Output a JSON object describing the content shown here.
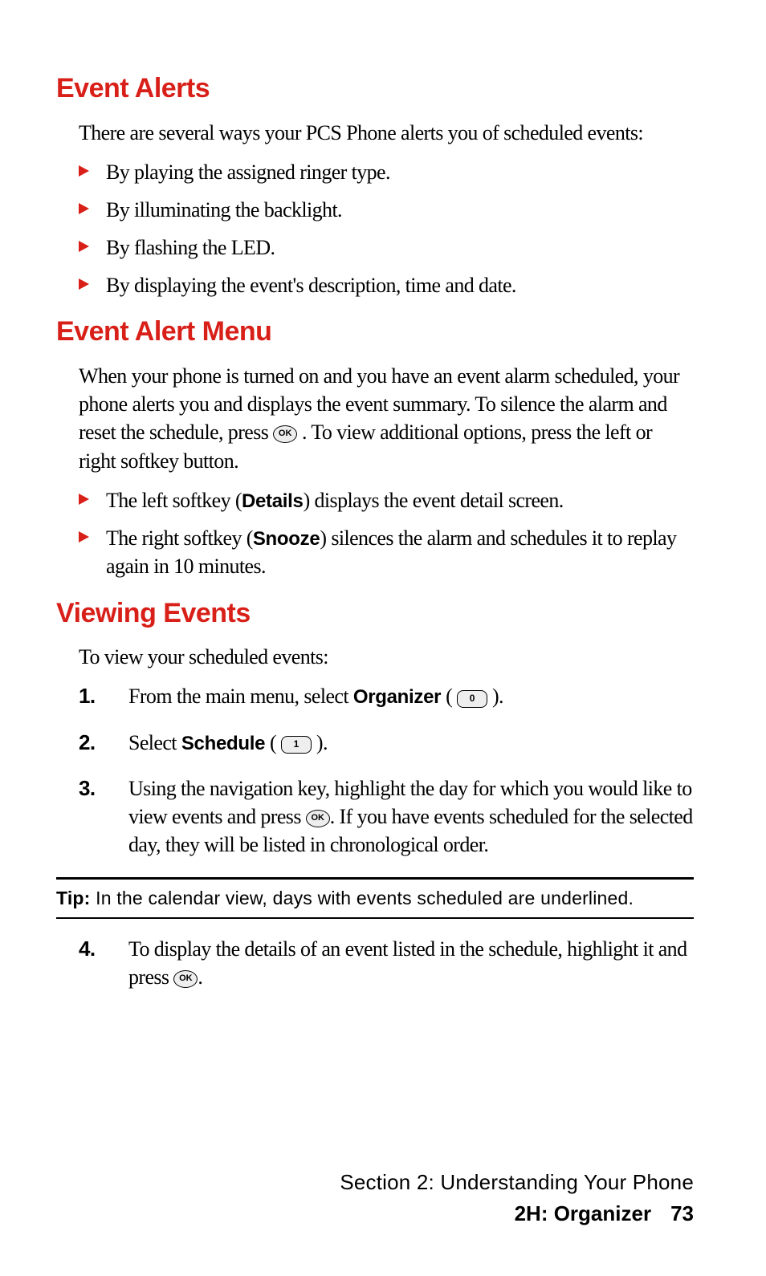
{
  "h1": "Event Alerts",
  "p1": "There are several ways your PCS Phone alerts you of scheduled events:",
  "alerts": [
    "By playing the assigned ringer type.",
    "By illuminating the backlight.",
    "By flashing the LED.",
    "By displaying the event's description, time and date."
  ],
  "h2": "Event Alert Menu",
  "p2a": "When your phone is turned on and you have an event alarm scheduled, your phone alerts you and displays the event summary. To silence the alarm and reset the schedule, press ",
  "p2b": ". To view additional options, press the left or right softkey button.",
  "menu": {
    "left_a": "The left softkey (",
    "left_bold": "Details",
    "left_b": ") displays the event detail screen.",
    "right_a": "The right softkey (",
    "right_bold": "Snooze",
    "right_b": ") silences the alarm and schedules it to replay again in 10 minutes."
  },
  "h3": "Viewing Events",
  "p3": "To view your scheduled events:",
  "steps": {
    "s1a": "From the main menu, select ",
    "s1bold": "Organizer",
    "s1b": " ( ",
    "s1key": "0",
    "s1c": " ).",
    "s2a": "Select ",
    "s2bold": "Schedule",
    "s2b": " ( ",
    "s2key": "1",
    "s2c": " ).",
    "s3a": "Using the navigation key, highlight the day for which you would like to view events and press ",
    "s3b": ". If you have events scheduled for the selected day, they will be listed in chronological order.",
    "s4a": "To display the details of an event listed in the schedule, highlight it and press ",
    "s4b": "."
  },
  "tip_label": "Tip:",
  "tip_text": " In the calendar view, days with events scheduled are underlined.",
  "ok_label": "OK",
  "footer": {
    "section": "Section 2: Understanding Your Phone",
    "sub": "2H: Organizer",
    "page": "73"
  }
}
